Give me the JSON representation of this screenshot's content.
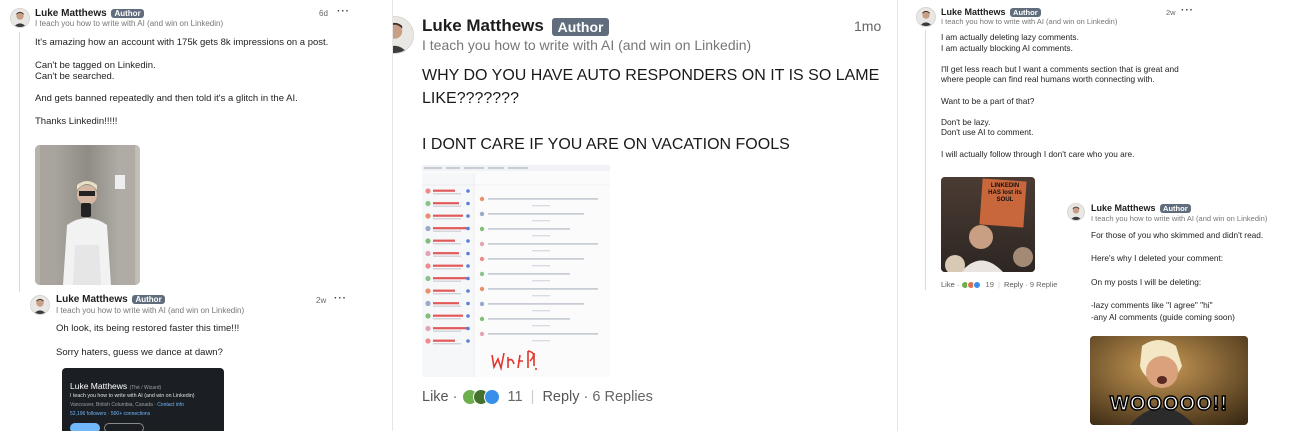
{
  "author_badge": "Author",
  "author_name": "Luke Matthews",
  "author_headline": "I teach you how to write with AI (and win on Linkedin)",
  "more_icon": "more-horizontal-icon",
  "left": {
    "comment1": {
      "time": "6d",
      "lines": [
        "It's amazing how an account with 175k gets 8k impressions on a post.",
        "",
        "Can't be tagged on Linkedin.",
        "Can't be searched.",
        "",
        "And gets banned repeatedly and then told it's a glitch in the AI.",
        "",
        "Thanks Linkedin!!!!!"
      ]
    },
    "reply1": {
      "time": "2w",
      "lines": [
        "Oh look, its being restored faster this time!!!",
        "",
        "Sorry haters, guess we dance at dawn?"
      ],
      "card": {
        "name": "Luke Matthews",
        "pronouns": "(Thé / Wizard)",
        "headline": "I teach you how to write with AI (and win on Linkedin)",
        "location": "Vancouver, British Columbia, Canada",
        "contact": "Contact info",
        "followers": "52,196 followers",
        "connections": "500+ connections"
      }
    }
  },
  "center": {
    "time": "1mo",
    "lines": [
      "WHY DO YOU HAVE AUTO RESPONDERS ON IT IS SO LAME",
      "LIKE???????",
      "",
      "I DONT CARE IF YOU ARE ON VACATION FOOLS"
    ],
    "scribble": "Why?!",
    "actions": {
      "like": "Like",
      "reactions": "11",
      "reply": "Reply",
      "replies": "6 Replies"
    }
  },
  "right": {
    "comment1": {
      "time": "2w",
      "lines": [
        "I am actually deleting lazy comments.",
        "I am actually blocking AI comments.",
        "",
        "I'll get less reach but I want a comments section that is great and",
        "where people can find real humans worth connecting with.",
        "",
        "Want to be a part of that?",
        "",
        "Don't be lazy.",
        "Don't use AI to comment.",
        "",
        "I will actually follow through I don't care who you are."
      ],
      "sign_text": "LINKEDIN HAS lost its SOUL",
      "actions": {
        "like": "Like",
        "reactions": "19",
        "reply": "Reply",
        "replies": "9 Replie"
      }
    },
    "reply1": {
      "lines": [
        "For those of you who skimmed and didn't read.",
        "",
        "Here's why I deleted your comment:",
        "",
        "On my posts I will be deleting:",
        "",
        "-lazy comments like \"I agree\" \"hi\"",
        "-any AI comments (guide coming soon)"
      ],
      "gif_caption": "WOOOOO!!"
    }
  },
  "colors": {
    "badge": "#5f6d7c",
    "like_blue": "#378fe9",
    "celebrate_green": "#44712e",
    "love_red": "#df704d",
    "scribble_red": "#e4342c"
  }
}
